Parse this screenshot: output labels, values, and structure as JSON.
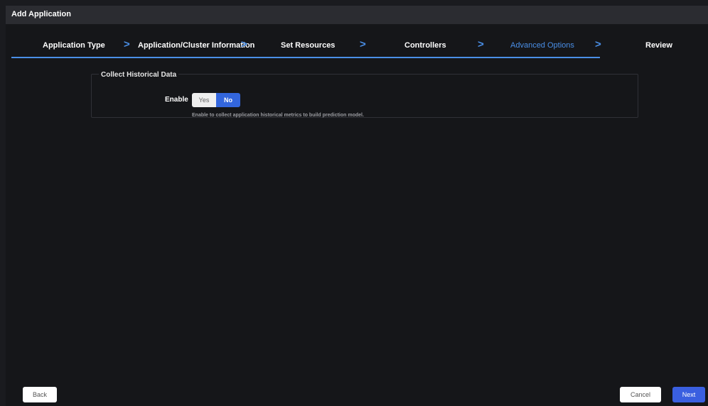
{
  "window": {
    "title": "Add Application"
  },
  "wizard": {
    "steps": [
      {
        "label": "Application Type",
        "state": "done"
      },
      {
        "label": "Application/Cluster Information",
        "state": "done"
      },
      {
        "label": "Set Resources",
        "state": "done"
      },
      {
        "label": "Controllers",
        "state": "done"
      },
      {
        "label": "Advanced Options",
        "state": "active"
      },
      {
        "label": "Review",
        "state": "pending"
      }
    ],
    "separator": ">"
  },
  "section": {
    "legend": "Collect Historical Data",
    "enable_label": "Enable",
    "toggle": {
      "yes": "Yes",
      "no": "No",
      "selected": "No"
    },
    "hint": "Enable to collect application historical metrics to build prediction model."
  },
  "footer": {
    "back": "Back",
    "cancel": "Cancel",
    "next": "Next"
  },
  "colors": {
    "accent": "#4a8fe7",
    "primary_button": "#3a5fe0",
    "background": "#151619"
  }
}
